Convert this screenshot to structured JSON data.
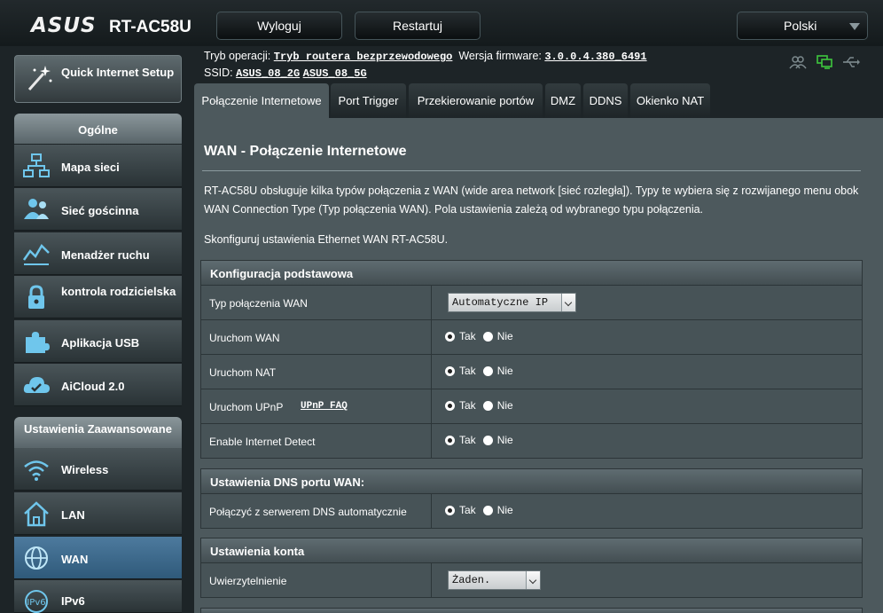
{
  "header": {
    "logo": "ASUS",
    "model": "RT-AC58U",
    "logout_label": "Wyloguj",
    "restart_label": "Restartuj",
    "language": "Polski"
  },
  "info": {
    "mode_label": "Tryb operacji:",
    "mode_value": "Tryb routera bezprzewodowego",
    "fw_label": "Wersja firmware:",
    "fw_value": "3.0.0.4.380_6491",
    "ssid_label": "SSID:",
    "ssid_24": "ASUS_08_2G",
    "ssid_5": "ASUS_08_5G"
  },
  "sidebar": {
    "quick_setup": "Quick Internet Setup",
    "general_header": "Ogólne",
    "general_items": [
      {
        "label": "Mapa sieci"
      },
      {
        "label": "Sieć gościnna"
      },
      {
        "label": "Menadżer ruchu"
      },
      {
        "label": "kontrola rodzicielska"
      },
      {
        "label": "Aplikacja USB"
      },
      {
        "label": "AiCloud 2.0"
      }
    ],
    "advanced_header": "Ustawienia Zaawansowane",
    "advanced_items": [
      {
        "label": "Wireless"
      },
      {
        "label": "LAN"
      },
      {
        "label": "WAN"
      },
      {
        "label": "IPv6"
      }
    ]
  },
  "tabs": [
    {
      "label": "Połączenie Internetowe"
    },
    {
      "label": "Port Trigger"
    },
    {
      "label": "Przekierowanie portów"
    },
    {
      "label": "DMZ"
    },
    {
      "label": "DDNS"
    },
    {
      "label": "Okienko NAT"
    }
  ],
  "main": {
    "title": "WAN - Połączenie Internetowe",
    "description": "RT-AC58U obsługuje kilka typów połączenia z WAN (wide area network [sieć rozległa]). Typy te wybiera się z rozwijanego menu obok WAN Connection Type (Typ połączenia WAN). Pola ustawienia zależą od wybranego typu połączenia.",
    "configure_text": "Skonfiguruj ustawienia Ethernet WAN RT-AC58U.",
    "yes_label": "Tak",
    "no_label": "Nie",
    "basic_section": "Konfiguracja podstawowa",
    "wan_type_label": "Typ połączenia WAN",
    "wan_type_value": "Automatyczne IP",
    "enable_wan_label": "Uruchom WAN",
    "enable_nat_label": "Uruchom NAT",
    "enable_upnp_label": "Uruchom UPnP",
    "upnp_faq": "UPnP FAQ",
    "internet_detect_label": "Enable Internet Detect",
    "dns_section": "Ustawienia DNS portu WAN:",
    "dns_auto_label": "Połączyć z serwerem DNS automatycznie",
    "account_section": "Ustawienia konta",
    "auth_label": "Uwierzytelnienie",
    "auth_value": "Żaden."
  },
  "colors": {
    "background": "#1d2427",
    "panel": "#4d595d",
    "active_nav": "#4d7a9e",
    "status_green": "#3ec63e"
  },
  "icons": [
    "magic-wand-icon",
    "network-map-icon",
    "guest-network-icon",
    "traffic-manager-icon",
    "lock-icon",
    "puzzle-icon",
    "cloud-icon",
    "wifi-icon",
    "home-icon",
    "globe-icon",
    "ipv6-icon",
    "users-icon",
    "monitor-icon",
    "usb-icon"
  ]
}
